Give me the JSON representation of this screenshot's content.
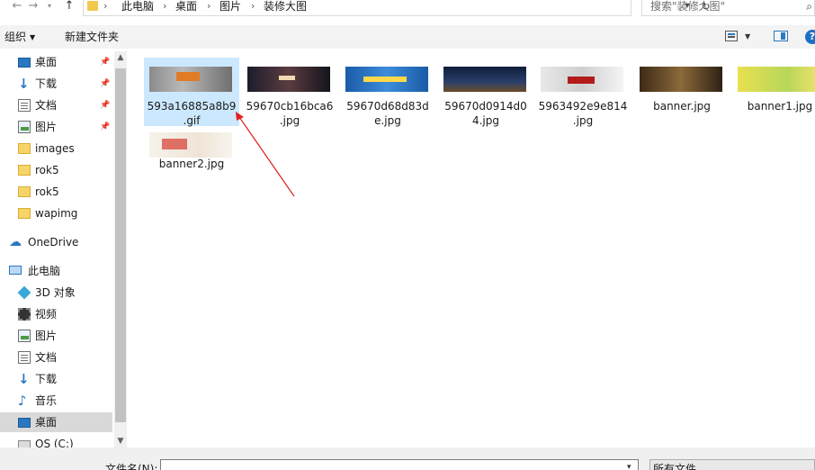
{
  "address": {
    "crumbs": [
      "此电脑",
      "桌面",
      "图片",
      "装修大图"
    ],
    "search_placeholder": "搜索\"装修大图\""
  },
  "toolbar": {
    "organize_label": "组织",
    "new_folder_label": "新建文件夹"
  },
  "sidebar": {
    "items": [
      {
        "label": "桌面",
        "icon": "desktop-icon",
        "pinned": true
      },
      {
        "label": "下载",
        "icon": "download-icon",
        "pinned": true
      },
      {
        "label": "文档",
        "icon": "document-icon",
        "pinned": true
      },
      {
        "label": "图片",
        "icon": "picture-icon",
        "pinned": true
      },
      {
        "label": "images",
        "icon": "folder-icon"
      },
      {
        "label": "rok5",
        "icon": "folder-icon"
      },
      {
        "label": "rok5",
        "icon": "folder-icon"
      },
      {
        "label": "wapimg",
        "icon": "folder-icon"
      },
      {
        "label": "OneDrive",
        "icon": "cloud-icon"
      },
      {
        "label": "此电脑",
        "icon": "computer-icon"
      },
      {
        "label": "3D 对象",
        "icon": "3d-objects-icon"
      },
      {
        "label": "视频",
        "icon": "video-icon"
      },
      {
        "label": "图片",
        "icon": "picture-icon"
      },
      {
        "label": "文档",
        "icon": "document-icon"
      },
      {
        "label": "下载",
        "icon": "download-icon"
      },
      {
        "label": "音乐",
        "icon": "music-icon"
      },
      {
        "label": "桌面",
        "icon": "desktop-icon"
      },
      {
        "label": "OS (C:)",
        "icon": "drive-icon"
      }
    ]
  },
  "files": [
    {
      "line1": "593a16885a8b9",
      "line2": ".gif",
      "selected": true
    },
    {
      "line1": "59670cb16bca6",
      "line2": ".jpg"
    },
    {
      "line1": "59670d68d83d",
      "line2": "e.jpg"
    },
    {
      "line1": "59670d0914d0",
      "line2": "4.jpg"
    },
    {
      "line1": "5963492e9e814",
      "line2": ".jpg"
    },
    {
      "line1": "banner.jpg",
      "line2": ""
    },
    {
      "line1": "banner1.jpg",
      "line2": ""
    },
    {
      "line1": "banner2.jpg",
      "line2": ""
    }
  ],
  "bottom": {
    "filename_label": "文件名(N):",
    "filename_value": "",
    "filetype_value": "所有文件"
  },
  "colors": {
    "selection": "#cce8ff",
    "arrow": "#e02020",
    "accent": "#2b78c2"
  }
}
